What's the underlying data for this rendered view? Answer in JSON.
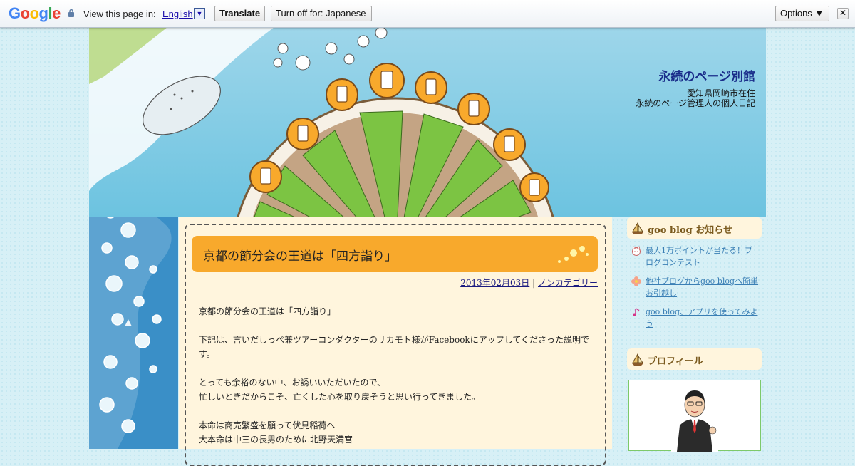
{
  "translate_bar": {
    "logo": "Google",
    "prompt": "View this page in:",
    "language": "English",
    "translate_label": "Translate",
    "turn_off_label": "Turn off for: Japanese",
    "options_label": "Options ▼",
    "close_label": "✕"
  },
  "header": {
    "title": "永続のページ別館",
    "subtitle_line1": "愛知県岡崎市在住",
    "subtitle_line2": "永続のページ管理人の個人日記"
  },
  "post": {
    "title": "京都の節分会の王道は「四方詣り」",
    "date": "2013年02月03日",
    "separator": "|",
    "category": "ノンカテゴリー",
    "body": [
      [
        "京都の節分会の王道は「四方詣り」"
      ],
      [
        "下記は、言いだしっぺ兼ツアーコンダクターのサカモト様がFacebookにアップしてくださった説明です。"
      ],
      [
        "とっても余裕のない中、お誘いいただいたので、",
        "忙しいときだからこそ、亡くした心を取り戻そうと思い行ってきました。"
      ],
      [
        "本命は商売繁盛を願って伏見稲荷へ",
        "大本命は中三の長男のために北野天満宮"
      ]
    ]
  },
  "sidebar": {
    "notice_heading": "goo blog お知らせ",
    "notices": [
      {
        "label": "最大1万ポイントが当たる！ブログコンテスト",
        "icon": "cat-face-icon"
      },
      {
        "label": "他社ブログからgoo blogへ簡単お引越し",
        "icon": "flower-icon"
      },
      {
        "label": "goo blog、アプリを使ってみよう",
        "icon": "music-note-icon"
      }
    ],
    "profile_heading": "プロフィール"
  },
  "colors": {
    "title_bar": "#f8a92c",
    "content_bg": "#fff5dd",
    "link": "#3a7fb5",
    "header_sky": "#6cc3e0"
  }
}
